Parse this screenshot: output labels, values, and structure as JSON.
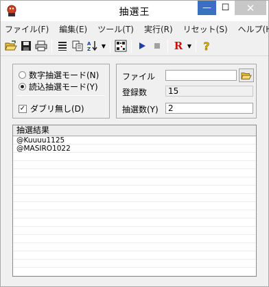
{
  "window": {
    "title": "抽選王",
    "min_glyph": "—",
    "max_glyph": "☐",
    "close_glyph": "✕"
  },
  "menu": [
    {
      "label": "ファイル(F)"
    },
    {
      "label": "編集(E)"
    },
    {
      "label": "ツール(T)"
    },
    {
      "label": "実行(R)"
    },
    {
      "label": "リセット(S)"
    },
    {
      "label": "ヘルプ(H)"
    }
  ],
  "toolbar": {
    "icons": [
      "open-folder-icon",
      "save-icon",
      "print-icon",
      "list-icon",
      "copy-icon",
      "sort-icon",
      "qr-code-icon",
      "play-icon",
      "stop-icon",
      "reset-r-icon",
      "help-icon"
    ],
    "reset_label": "R",
    "help_label": "?"
  },
  "mode": {
    "radio_numeric": "数字抽選モード(N)",
    "radio_load": "読込抽選モード(Y)",
    "selected": "load",
    "no_duplicates_label": "ダブリ無し(D)",
    "no_duplicates_checked": true,
    "check_glyph": "✓"
  },
  "settings": {
    "file_label": "ファイル",
    "file_value": "",
    "count_label": "登録数",
    "count_value": "15",
    "draw_label": "抽選数(Y)",
    "draw_value": "2"
  },
  "results": {
    "header": "抽選結果",
    "rows": [
      "@Kuuuu1125",
      "@MASIRO1022",
      "",
      "",
      "",
      "",
      "",
      "",
      "",
      "",
      "",
      "",
      "",
      "",
      "",
      "",
      ""
    ]
  },
  "colors": {
    "accent": "#3c6fc0",
    "close_bg": "#c7c7c7",
    "play": "#1f3fa8",
    "reset_r": "#d01010",
    "help": "#e0b000"
  }
}
